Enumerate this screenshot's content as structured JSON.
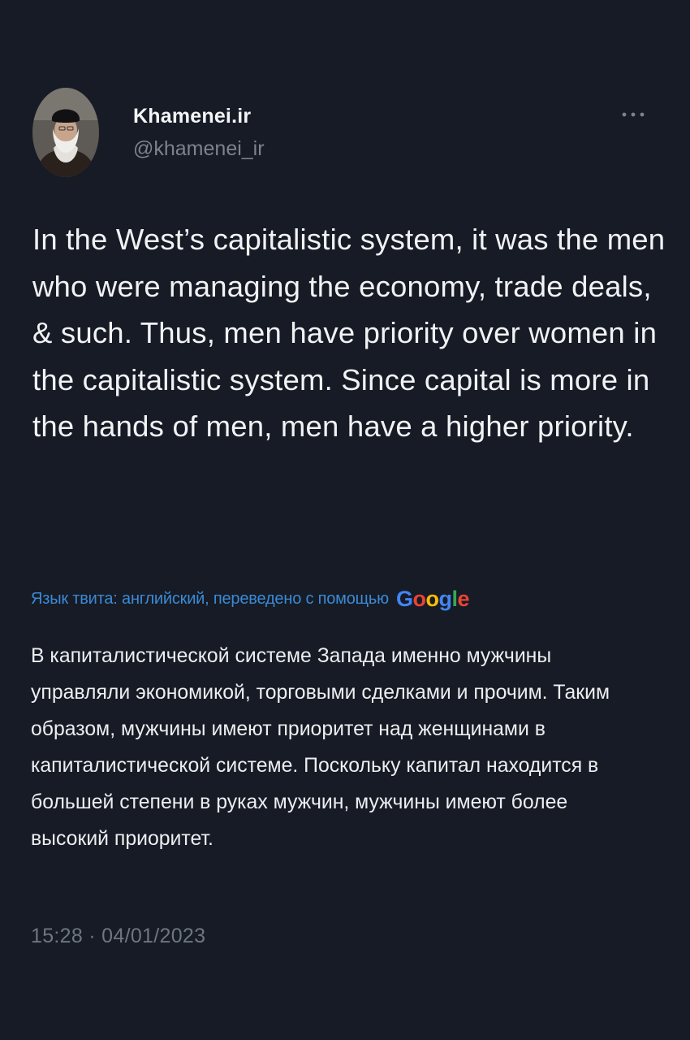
{
  "author": {
    "display_name": "Khamenei.ir",
    "handle": "@khamenei_ir"
  },
  "icons": {
    "avatar": "avatar-portrait",
    "more": "more-horizontal-icon"
  },
  "tweet": {
    "text": "In the West’s capitalistic system, it was the men who were managing the economy, trade deals, & such. Thus, men have priority over women in the capitalistic system. Since capital is more in the hands of men, men have a higher priority.",
    "translation_label": "Язык твита: английский, переведено с помощью",
    "translator_brand": "Google",
    "translated_text": "В капиталистической системе Запада именно мужчины управляли экономикой, торговыми сделками и прочим. Таким образом, мужчины имеют приоритет над женщинами в капиталистической системе. Поскольку капитал находится в большей степени в руках мужчин, мужчины имеют более высокий приоритет.",
    "timestamp": "15:28 · 04/01/2023"
  },
  "colors": {
    "background": "#161b25",
    "text": "#f1f2f4",
    "muted": "#7c838c",
    "link": "#3b8ad6",
    "google_blue": "#4285f4",
    "google_red": "#ea4335",
    "google_yellow": "#fbbc05",
    "google_green": "#34a853"
  }
}
